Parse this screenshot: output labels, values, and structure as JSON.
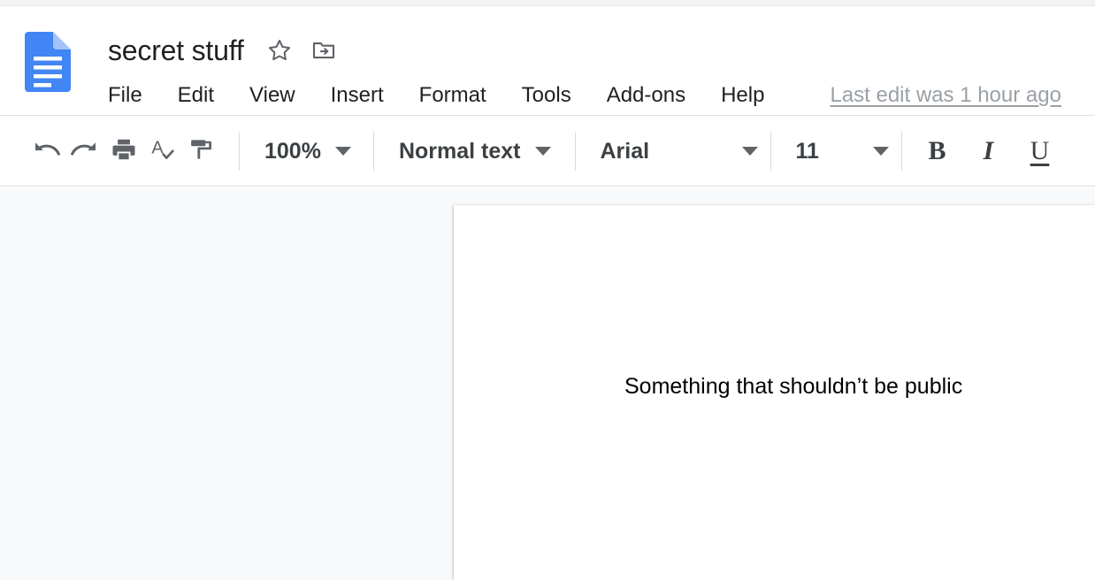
{
  "app": {
    "name": "Google Docs",
    "icon": "docs-file-icon",
    "accent_blue": "#4285f4",
    "icon_gray": "#5f6368",
    "text_dark": "#202124",
    "canvas_bg": "#f8f9fa",
    "page_bg": "#ffffff"
  },
  "header": {
    "doc_title": "secret stuff",
    "star_icon": "star-outline-icon",
    "move_to_folder_icon": "folder-move-icon",
    "menus": [
      {
        "label": "File"
      },
      {
        "label": "Edit"
      },
      {
        "label": "View"
      },
      {
        "label": "Insert"
      },
      {
        "label": "Format"
      },
      {
        "label": "Tools"
      },
      {
        "label": "Add-ons"
      },
      {
        "label": "Help"
      }
    ],
    "last_edit": "Last edit was 1 hour ago"
  },
  "toolbar": {
    "buttons": [
      {
        "name": "undo",
        "icon": "undo-arrow-icon"
      },
      {
        "name": "redo",
        "icon": "redo-arrow-icon"
      },
      {
        "name": "print",
        "icon": "printer-icon"
      },
      {
        "name": "spelling",
        "icon": "spellcheck-icon"
      },
      {
        "name": "paint-format",
        "icon": "paint-roller-icon"
      }
    ],
    "zoom": {
      "value": "100%",
      "caret": "chevron-down-icon"
    },
    "style": {
      "value": "Normal text",
      "caret": "chevron-down-icon"
    },
    "font": {
      "value": "Arial",
      "caret": "chevron-down-icon"
    },
    "font_size": {
      "value": "11",
      "caret": "chevron-down-icon"
    },
    "bold_label": "B",
    "italic_label": "I",
    "underline_label": "U"
  },
  "document": {
    "paragraph": "Something that shouldn’t be public"
  }
}
